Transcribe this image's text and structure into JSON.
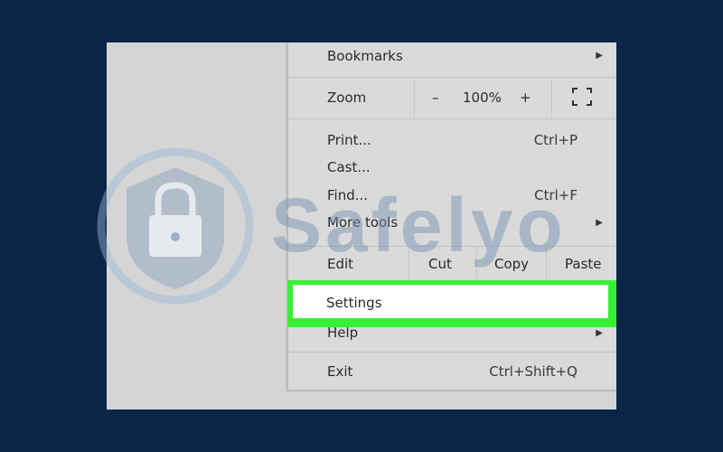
{
  "menu": {
    "bookmarks": "Bookmarks",
    "zoom": {
      "label": "Zoom",
      "minus": "–",
      "value": "100%",
      "plus": "+"
    },
    "print": {
      "label": "Print...",
      "shortcut": "Ctrl+P"
    },
    "cast": {
      "label": "Cast..."
    },
    "find": {
      "label": "Find...",
      "shortcut": "Ctrl+F"
    },
    "more_tools": "More tools",
    "edit": {
      "label": "Edit",
      "cut": "Cut",
      "copy": "Copy",
      "paste": "Paste"
    },
    "settings": "Settings",
    "help": "Help",
    "exit": {
      "label": "Exit",
      "shortcut": "Ctrl+Shift+Q"
    }
  },
  "colors": {
    "highlight": "#35f035",
    "background": "#0b2447"
  },
  "watermark": {
    "text": "Safelyo"
  }
}
